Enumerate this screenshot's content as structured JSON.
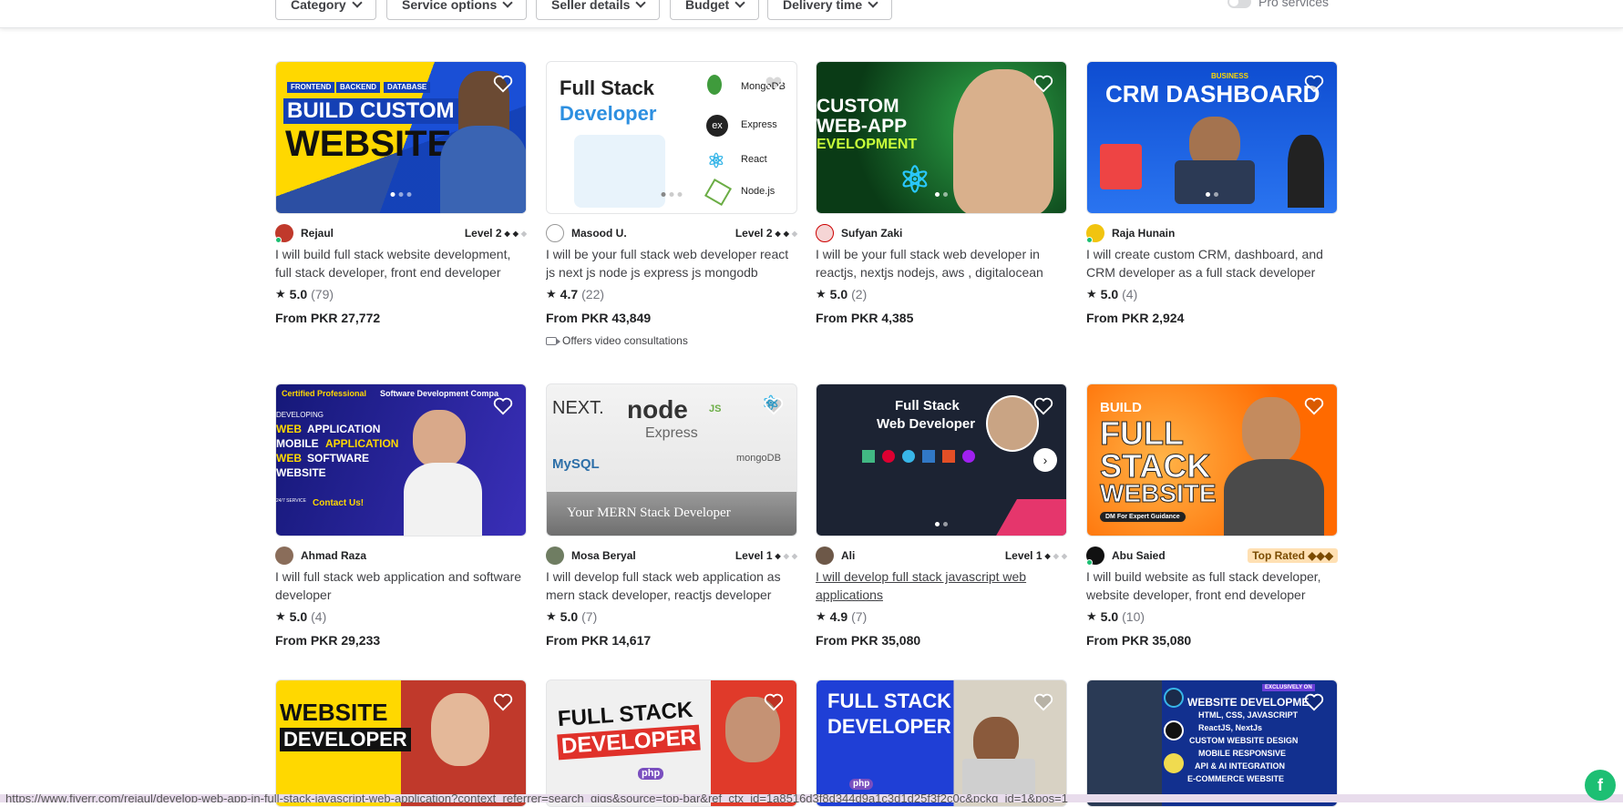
{
  "filters": {
    "category": "Category",
    "service_options": "Service options",
    "seller_details": "Seller details",
    "budget": "Budget",
    "delivery_time": "Delivery time",
    "pro_services": "Pro services"
  },
  "gigs": [
    {
      "seller": "Rejaul",
      "level": "Level 2",
      "title": "I will build full stack website development, full stack developer, front end developer",
      "rating": "5.0",
      "reviews": "(79)",
      "price": "From PKR 27,772",
      "thumb_text": {
        "l1": "FRONTEND",
        "l2": "BACKEND",
        "l3": "DATABASE",
        "t1": "BUILD CUSTOM",
        "t2": "WEBSITE"
      }
    },
    {
      "seller": "Masood U.",
      "level": "Level 2",
      "title": "I will be your full stack web developer react js next js node js express js mongodb",
      "rating": "4.7",
      "reviews": "(22)",
      "price": "From PKR 43,849",
      "extra": "Offers video consultations",
      "thumb_text": {
        "t1": "Full Stack",
        "t2": "Developer",
        "s1": "MongoDB",
        "s2": "Express",
        "s3": "React",
        "s4": "Node.js",
        "ex": "ex"
      }
    },
    {
      "seller": "Sufyan Zaki",
      "title": "I will be your full stack web developer in reactjs, nextjs nodejs, aws , digitalocean",
      "rating": "5.0",
      "reviews": "(2)",
      "price": "From PKR 4,385",
      "thumb_text": {
        "t1": "CUSTOM",
        "t2": "WEB-APP",
        "t3": "EVELOPMENT"
      }
    },
    {
      "seller": "Raja Hunain",
      "title": "I will create custom CRM, dashboard, and CRM developer as a full stack developer",
      "rating": "5.0",
      "reviews": "(4)",
      "price": "From PKR 2,924",
      "thumb_text": {
        "t0": "BUSINESS",
        "t1": "CRM DASHBOARD"
      }
    },
    {
      "seller": "Ahmad Raza",
      "title": "I will full stack web application and software developer",
      "rating": "5.0",
      "reviews": "(4)",
      "price": "From PKR 29,233",
      "thumb_text": {
        "t0a": "Certified Professional",
        "t0b": " Software Development Compa",
        "t1": "DEVELOPING",
        "t2": "WEB",
        "t2b": " APPLICATION",
        "t3": "MOBILE",
        "t3b": " APPLICATION",
        "t4": "WEB",
        "t4b": " SOFTWARE",
        "t5": "WEBSITE",
        "t6": "Contact Us!",
        "t7": "24/7 SERVICE"
      }
    },
    {
      "seller": "Mosa Beryal",
      "level": "Level 1",
      "title": "I will develop full stack web application as mern stack developer, reactjs developer",
      "rating": "5.0",
      "reviews": "(7)",
      "price": "From PKR 14,617",
      "thumb_text": {
        "t1": "NEXT.",
        "t2": "node",
        "t2b": "JS",
        "t3": "Express",
        "t4": "MySQL",
        "t5": "mongoDB",
        "t6": "Your MERN Stack Developer"
      }
    },
    {
      "seller": "Ali",
      "level": "Level 1",
      "title": "I will develop full stack javascript web applications",
      "rating": "4.9",
      "reviews": "(7)",
      "price": "From PKR 35,080",
      "thumb_text": {
        "t1": "Full Stack",
        "t2": "Web Developer"
      }
    },
    {
      "seller": "Abu Saied",
      "level": "Top Rated",
      "title": "I will build website as full stack developer, website developer, front end developer",
      "rating": "5.0",
      "reviews": "(10)",
      "price": "From PKR 35,080",
      "thumb_text": {
        "t0": "BUILD",
        "t1": "FULL",
        "t2": "STACK",
        "t3": "WEBSITE",
        "t4": "DM For Expert Guidance"
      }
    },
    {
      "thumb_text": {
        "t1": "WEBSITE",
        "t2": "DEVELOPER"
      }
    },
    {
      "thumb_text": {
        "t1": "FULL STACK",
        "t2": "DEVELOPER",
        "t3": "php"
      }
    },
    {
      "thumb_text": {
        "t1": "FULL STACK",
        "t2": "DEVELOPER",
        "t3": "php"
      }
    },
    {
      "thumb_text": {
        "t0": "EXCLUSIVELY ON",
        "t1": "WEBSITE DEVELOPME",
        "t2": "HTML, CSS, JAVASCRIPT",
        "t3": "ReactJS, NextJs",
        "t4": "CUSTOM WEBSITE DESIGN",
        "t5": "MOBILE RESPONSIVE",
        "t6": "API & AI INTEGRATION",
        "t7": "E-COMMERCE WEBSITE"
      }
    }
  ],
  "status_url": "https://www.fiverr.com/rejaul/develop-web-app-in-full-stack-javascript-web-application?context_referrer=search_gigs&source=top-bar&ref_ctx_id=1a8516d3f8d344d9a1c3d1d25f3f2c0c&pckg_id=1&pos=1",
  "fab_label": "f"
}
